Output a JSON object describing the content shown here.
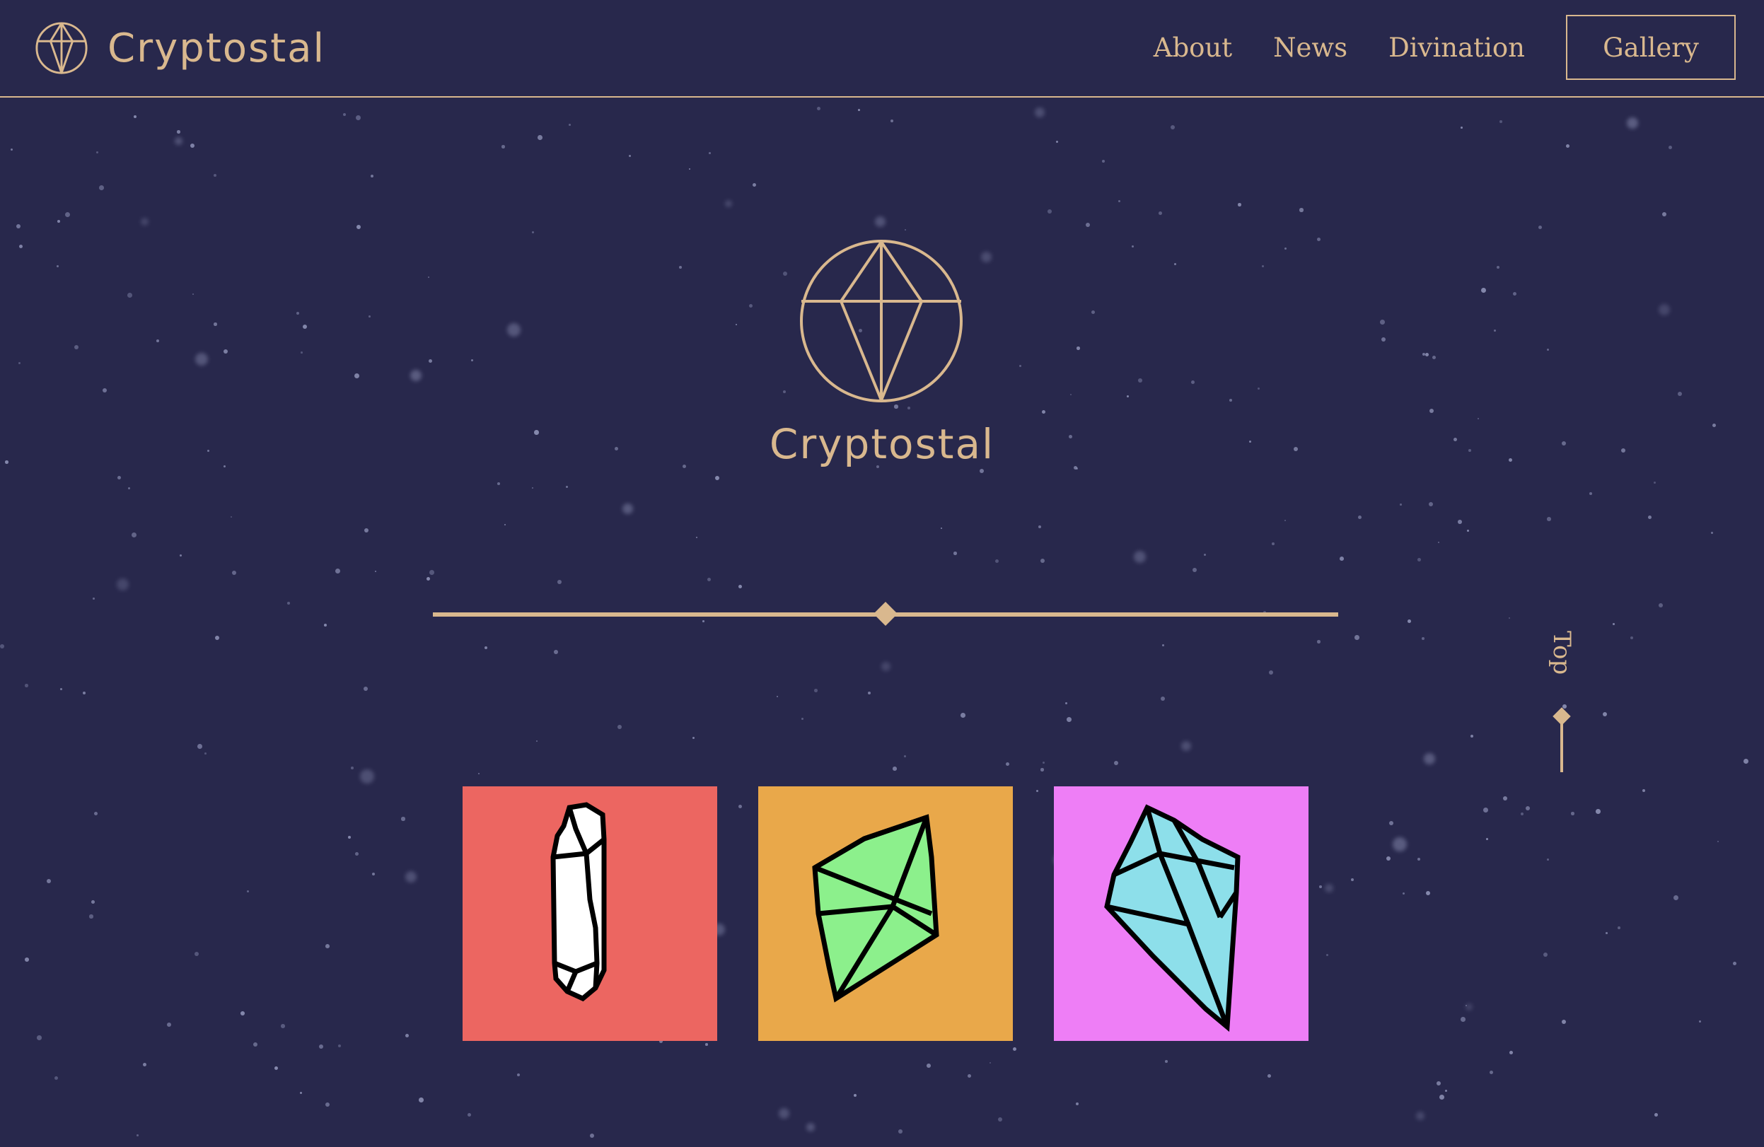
{
  "header": {
    "brand_name": "Cryptostal",
    "nav": [
      "About",
      "News",
      "Divination"
    ],
    "cta_label": "Gallery"
  },
  "hero": {
    "title": "Cryptostal"
  },
  "scroll_top": {
    "label": "Top"
  },
  "gallery": {
    "tiles": [
      {
        "name": "white-crystal",
        "background": "#ec6661",
        "crystal_color": "#ffffff"
      },
      {
        "name": "green-crystal",
        "background": "#e9a84a",
        "crystal_color": "#8cf08c"
      },
      {
        "name": "blue-crystal",
        "background": "#ee7ef6",
        "crystal_color": "#8ddfea"
      }
    ]
  },
  "colors": {
    "background": "#28284c",
    "accent": "#d9b88e"
  },
  "icons": [
    "crystal-logo-icon",
    "crystal-emblem-icon",
    "diamond-icon"
  ]
}
